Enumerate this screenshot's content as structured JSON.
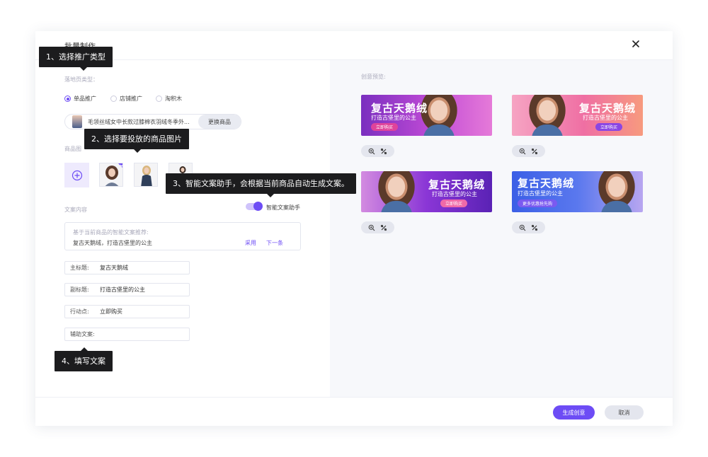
{
  "dialog": {
    "title": "批量制作",
    "close_icon": "close-icon"
  },
  "left": {
    "landing_type_label": "落地页类型：",
    "radios": [
      {
        "label": "单品推广",
        "checked": true
      },
      {
        "label": "店铺推广",
        "checked": false
      },
      {
        "label": "淘积木",
        "checked": false
      }
    ],
    "product_name": "毛领丝绒女中长款过膝棉衣羽绒冬季外...",
    "swap_button": "更换商品",
    "product_images_label": "商品图",
    "copy_label": "文案内容",
    "assistant_label": "智能文案助手",
    "suggest_title": "基于当前商品的智能文案推荐:",
    "suggest_text": "复古天鹅绒，打造古堡里的公主",
    "adopt_link": "采用",
    "next_link": "下一条",
    "fields": [
      {
        "label": "主标题:",
        "value": "复古天鹅绒"
      },
      {
        "label": "副标题:",
        "value": "打造古堡里的公主"
      },
      {
        "label": "行动点:",
        "value": "立即购买"
      },
      {
        "label": "辅助文案:",
        "value": ""
      }
    ]
  },
  "right": {
    "preview_label": "创意预览:",
    "banners": [
      {
        "title": "复古天鹅绒",
        "sub": "打造古堡里的公主",
        "cta": "立即购买"
      },
      {
        "title": "复古天鹅绒",
        "sub": "打造古堡里的公主",
        "cta": "立即购买"
      },
      {
        "title": "复古天鹅绒",
        "sub": "打造古堡里的公主",
        "cta": "立即购买"
      },
      {
        "title": "复古天鹅绒",
        "sub": "打造古堡里的公主",
        "cta": "更多优惠抢先购"
      }
    ]
  },
  "tooltips": {
    "t1": "1、选择推广类型",
    "t2": "2、选择要投放的商品图片",
    "t3": "3、智能文案助手，会根据当前商品自动生成文案。",
    "t4": "4、填写文案"
  },
  "footer": {
    "generate_button": "生成创意",
    "cancel_button": "取消"
  },
  "colors": {
    "accent": "#6d4cf5",
    "tooltip_bg": "#1c1c1e"
  }
}
